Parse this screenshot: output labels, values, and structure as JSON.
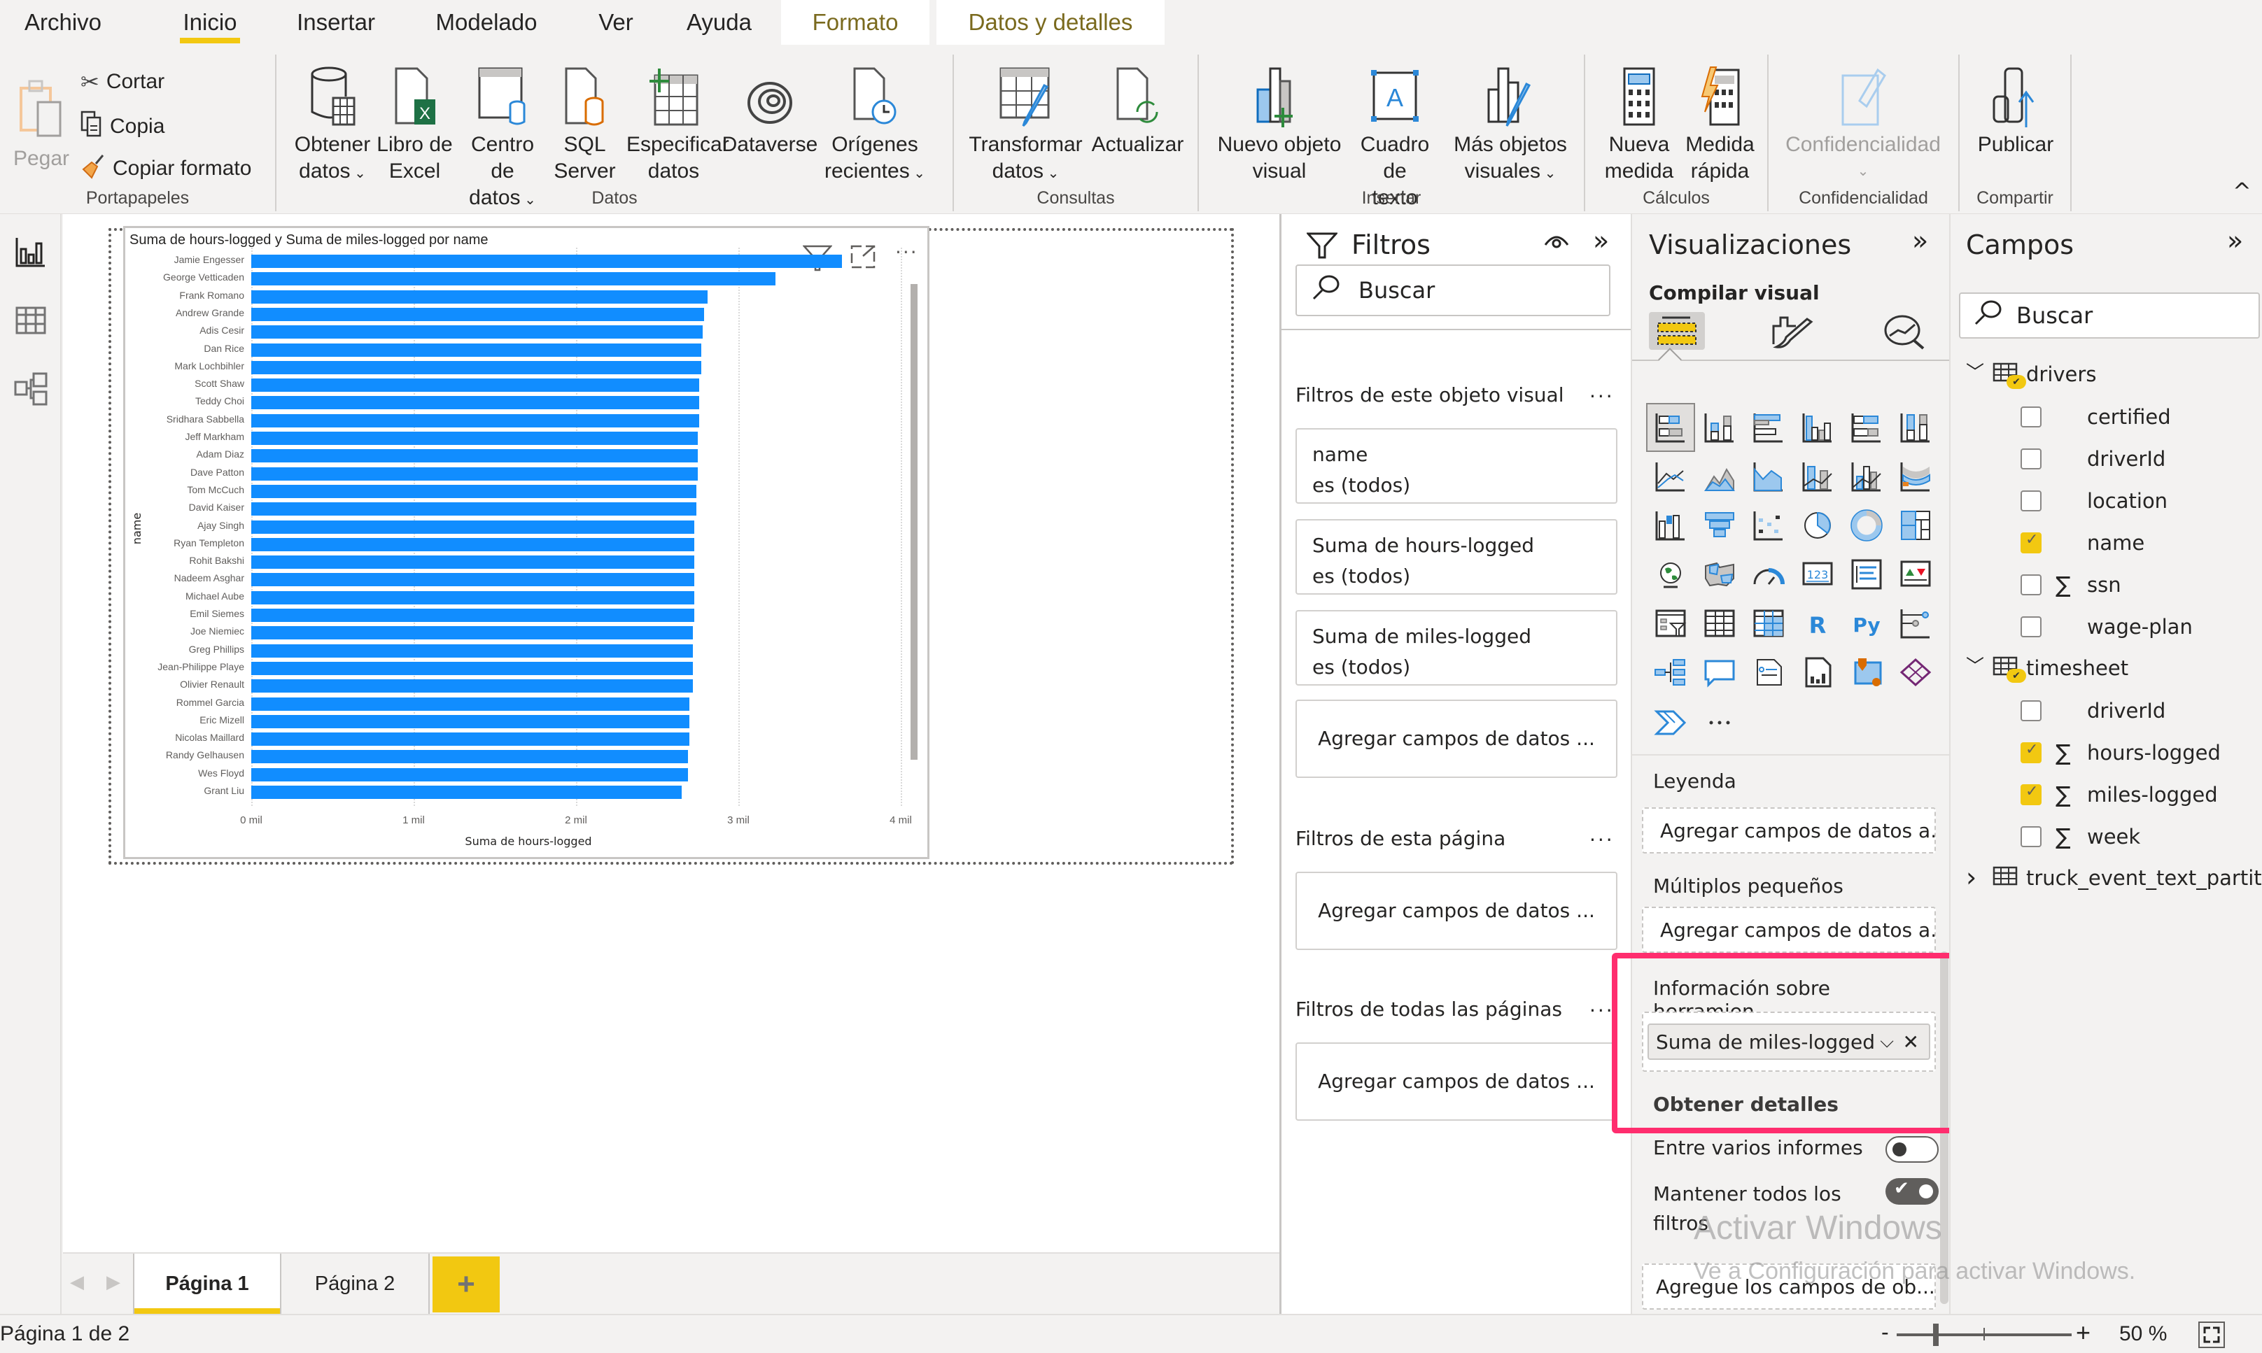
{
  "menu": {
    "tabs": [
      {
        "label": "Archivo"
      },
      {
        "label": "Inicio",
        "active": true
      },
      {
        "label": "Insertar"
      },
      {
        "label": "Modelado"
      },
      {
        "label": "Ver"
      },
      {
        "label": "Ayuda"
      },
      {
        "label": "Formato",
        "contextual": true
      },
      {
        "label": "Datos y detalles",
        "contextual": true
      }
    ]
  },
  "ribbon": {
    "portapapeles": {
      "group_label": "Portapapeles",
      "paste": "Pegar",
      "cut": "Cortar",
      "copy": "Copia",
      "format_painter": "Copiar formato"
    },
    "datos": {
      "group_label": "Datos",
      "buttons": [
        {
          "line1": "Obtener",
          "line2": "datos",
          "dropdown": true
        },
        {
          "line1": "Libro de",
          "line2": "Excel"
        },
        {
          "line1": "Centro de",
          "line2": "datos",
          "dropdown": true
        },
        {
          "line1": "SQL",
          "line2": "Server"
        },
        {
          "line1": "Especificar",
          "line2": "datos"
        },
        {
          "line1": "Dataverse",
          "line2": ""
        },
        {
          "line1": "Orígenes",
          "line2": "recientes",
          "dropdown": true
        }
      ]
    },
    "consultas": {
      "group_label": "Consultas",
      "buttons": [
        {
          "line1": "Transformar",
          "line2": "datos",
          "dropdown": true
        },
        {
          "line1": "Actualizar",
          "line2": ""
        }
      ]
    },
    "insertar": {
      "group_label": "Insertar",
      "buttons": [
        {
          "line1": "Nuevo objeto",
          "line2": "visual"
        },
        {
          "line1": "Cuadro de",
          "line2": "texto"
        },
        {
          "line1": "Más objetos",
          "line2": "visuales",
          "dropdown": true
        }
      ]
    },
    "calculos": {
      "group_label": "Cálculos",
      "buttons": [
        {
          "line1": "Nueva",
          "line2": "medida"
        },
        {
          "line1": "Medida",
          "line2": "rápida"
        }
      ]
    },
    "confidencialidad": {
      "group_label": "Confidencialidad",
      "buttons": [
        {
          "line1": "Confidencialidad",
          "line2": "",
          "dropdown": true,
          "disabled": true
        }
      ]
    },
    "compartir": {
      "group_label": "Compartir",
      "buttons": [
        {
          "line1": "Publicar",
          "line2": ""
        }
      ]
    },
    "collapse_glyph": "^"
  },
  "visual": {
    "title": "Suma de hours-logged y Suma de miles-logged por name",
    "y_axis_label": "name",
    "x_axis_label": "Suma de hours-logged"
  },
  "chart_data": {
    "type": "bar",
    "orientation": "horizontal",
    "title": "Suma de hours-logged y Suma de miles-logged por name",
    "xlabel": "Suma de hours-logged",
    "ylabel": "name",
    "xlim": [
      0,
      4000
    ],
    "x_ticks": [
      {
        "value": 0,
        "label": "0 mil"
      },
      {
        "value": 1000,
        "label": "1 mil"
      },
      {
        "value": 2000,
        "label": "2 mil"
      },
      {
        "value": 3000,
        "label": "3 mil"
      },
      {
        "value": 4000,
        "label": "4 mil"
      }
    ],
    "grid": true,
    "bar_color": "#118dff",
    "categories": [
      "Jamie Engesser",
      "George Vetticaden",
      "Frank Romano",
      "Andrew Grande",
      "Adis Cesir",
      "Dan Rice",
      "Mark Lochbihler",
      "Scott Shaw",
      "Teddy Choi",
      "Sridhara Sabbella",
      "Jeff Markham",
      "Adam Diaz",
      "Dave Patton",
      "Tom McCuch",
      "David Kaiser",
      "Ajay Singh",
      "Ryan Templeton",
      "Rohit Bakshi",
      "Nadeem Asghar",
      "Michael Aube",
      "Emil Siemes",
      "Joe Niemiec",
      "Greg Phillips",
      "Jean-Philippe Playe",
      "Olivier Renault",
      "Rommel Garcia",
      "Eric Mizell",
      "Nicolas Maillard",
      "Randy Gelhausen",
      "Wes Floyd",
      "Grant Liu"
    ],
    "series": [
      {
        "name": "Suma de hours-logged",
        "values": [
          3640,
          3230,
          2810,
          2790,
          2780,
          2770,
          2770,
          2760,
          2760,
          2760,
          2750,
          2750,
          2750,
          2740,
          2740,
          2730,
          2730,
          2730,
          2730,
          2730,
          2730,
          2720,
          2720,
          2720,
          2720,
          2700,
          2700,
          2700,
          2690,
          2690,
          2650
        ]
      }
    ]
  },
  "filters": {
    "title": "Filtros",
    "search_placeholder": "Buscar",
    "visual_section": "Filtros de este objeto visual",
    "visual_cards": [
      {
        "field": "name",
        "condition": "es (todos)"
      },
      {
        "field": "Suma de hours-logged",
        "condition": "es (todos)"
      },
      {
        "field": "Suma de miles-logged",
        "condition": "es (todos)"
      }
    ],
    "add_fields": "Agregar campos de datos ...",
    "page_section": "Filtros de esta página",
    "all_pages_section": "Filtros de todas las páginas",
    "more": "..."
  },
  "visualizations": {
    "title": "Visualizaciones",
    "build_label": "Compilar visual",
    "more_visuals": "...",
    "legend_label": "Leyenda",
    "legend_well": "Agregar campos de datos a...",
    "small_multiples_label": "Múltiplos pequeños",
    "small_multiples_well": "Agregar campos de datos a...",
    "tooltips_label": "Información sobre herramien...",
    "tooltips_field": "Suma de miles-logged",
    "drillthrough_label": "Obtener detalles",
    "cross_report_label": "Entre varios informes",
    "cross_report_on": false,
    "keep_filters_label": "Mantener todos los filtros",
    "keep_filters_on": true,
    "drillthrough_well": "Agregue los campos de ob...",
    "highlight_color": "#ff2d6e"
  },
  "fields": {
    "title": "Campos",
    "search_placeholder": "Buscar",
    "tables": [
      {
        "name": "drivers",
        "expanded": true,
        "has_selected": true,
        "fields": [
          {
            "name": "certified",
            "checked": false,
            "sigma": false
          },
          {
            "name": "driverId",
            "checked": false,
            "sigma": false
          },
          {
            "name": "location",
            "checked": false,
            "sigma": false
          },
          {
            "name": "name",
            "checked": true,
            "sigma": false
          },
          {
            "name": "ssn",
            "checked": false,
            "sigma": true
          },
          {
            "name": "wage-plan",
            "checked": false,
            "sigma": false
          }
        ]
      },
      {
        "name": "timesheet",
        "expanded": true,
        "has_selected": true,
        "fields": [
          {
            "name": "driverId",
            "checked": false,
            "sigma": false
          },
          {
            "name": "hours-logged",
            "checked": true,
            "sigma": true
          },
          {
            "name": "miles-logged",
            "checked": true,
            "sigma": true
          },
          {
            "name": "week",
            "checked": false,
            "sigma": true
          }
        ]
      },
      {
        "name": "truck_event_text_partiti...",
        "expanded": false,
        "has_selected": false,
        "fields": []
      }
    ]
  },
  "pages": {
    "tabs": [
      {
        "label": "Página 1",
        "active": true
      },
      {
        "label": "Página 2",
        "active": false
      }
    ],
    "add_glyph": "+"
  },
  "status": {
    "page_indicator": "Página 1 de 2",
    "zoom_minus": "-",
    "zoom_plus": "+",
    "zoom_level": "50 %"
  },
  "watermark": {
    "line1": "Activar Windows",
    "line2": "Ve a Configuración para activar Windows."
  },
  "colors": {
    "accent": "#f2c811",
    "bar": "#118dff",
    "highlight": "#ff2d6e"
  }
}
